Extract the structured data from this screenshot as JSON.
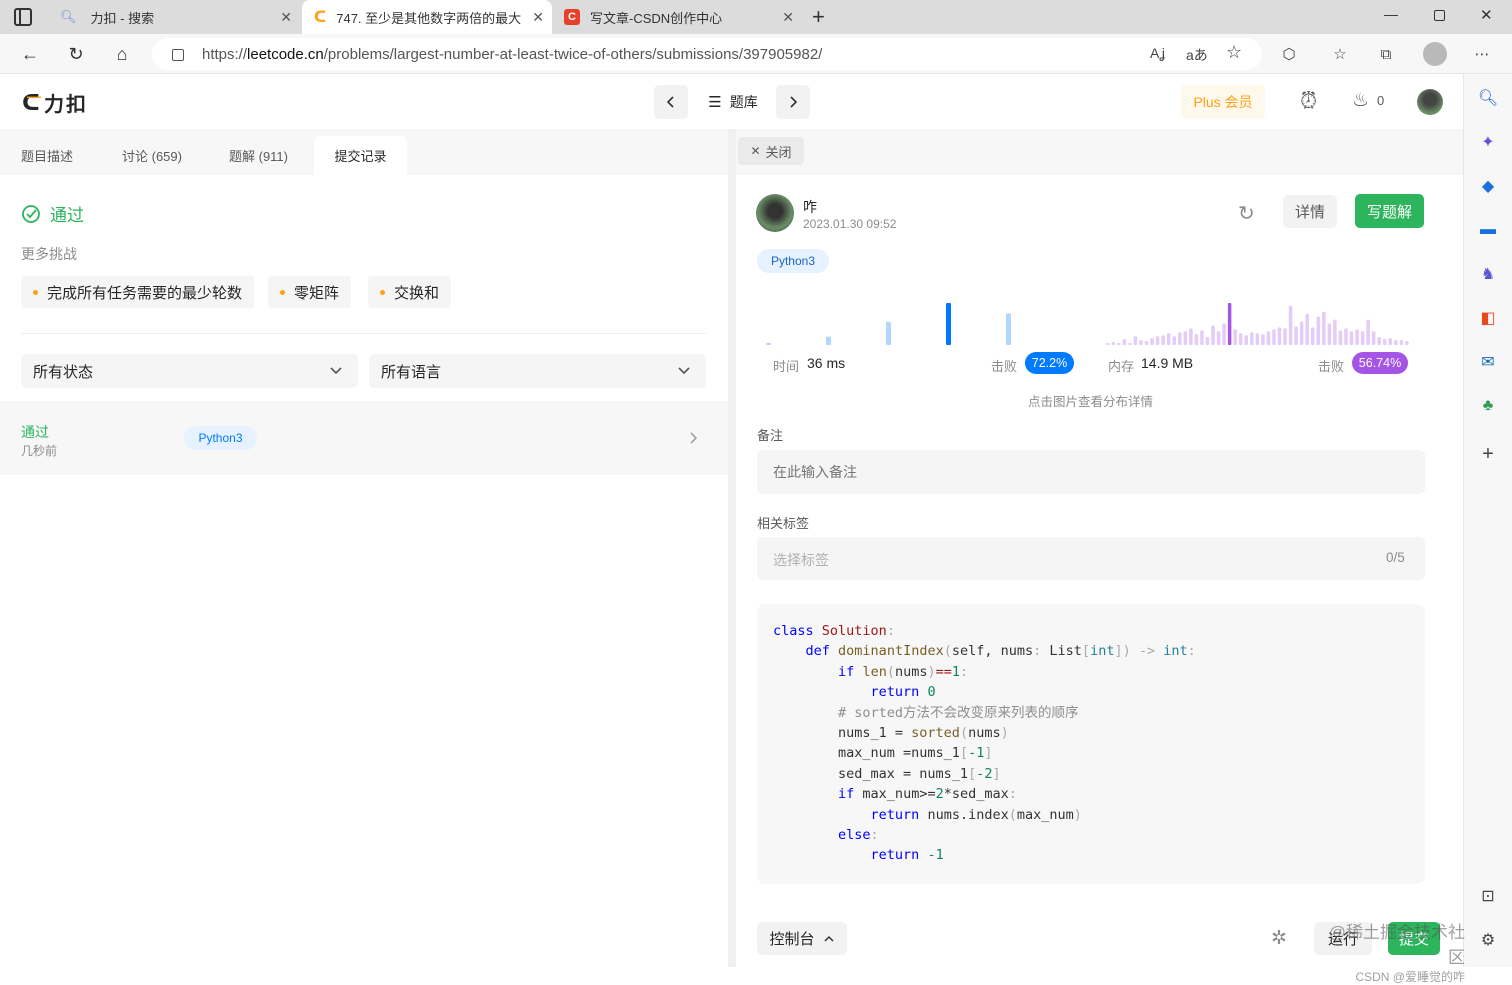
{
  "browser": {
    "tabs": [
      {
        "title": "力扣 - 搜索"
      },
      {
        "title": "747. 至少是其他数字两倍的最大"
      },
      {
        "title": "写文章-CSDN创作中心"
      }
    ],
    "url_prefix": "https://",
    "url_domain": "leetcode.cn",
    "url_path": "/problems/largest-number-at-least-twice-of-others/submissions/397905982/"
  },
  "header": {
    "logo_text": "力扣",
    "problem_list_label": "题库",
    "plus_label": "Plus 会员",
    "streak_count": "0"
  },
  "left": {
    "tabs": [
      {
        "label": "题目描述"
      },
      {
        "label": "讨论 (659)"
      },
      {
        "label": "题解 (911)"
      },
      {
        "label": "提交记录"
      }
    ],
    "result_label": "通过",
    "more_challenges_label": "更多挑战",
    "challenges": [
      {
        "label": "完成所有任务需要的最少轮数"
      },
      {
        "label": "零矩阵"
      },
      {
        "label": "交换和"
      }
    ],
    "filter_status": "所有状态",
    "filter_language": "所有语言",
    "submission": {
      "status": "通过",
      "time": "几秒前",
      "language": "Python3"
    }
  },
  "right": {
    "close_label": "关闭",
    "user_name": "咋",
    "submit_time": "2023.01.30 09:52",
    "details_label": "详情",
    "write_solution_label": "写题解",
    "language_badge": "Python3",
    "runtime_label": "时间",
    "runtime_value": "36 ms",
    "runtime_beats_label": "击败",
    "runtime_beats_value": "72.2%",
    "memory_label": "内存",
    "memory_value": "14.9 MB",
    "memory_beats_label": "击败",
    "memory_beats_value": "56.74%",
    "chart_hint": "点击图片查看分布详情",
    "notes_label": "备注",
    "notes_placeholder": "在此输入备注",
    "tags_label": "相关标签",
    "tags_placeholder": "选择标签",
    "tags_count": "0/5",
    "console_label": "控制台",
    "run_label": "运行",
    "submit_label": "提交",
    "colors": {
      "green": "#2db55d",
      "blue": "#007aff",
      "purple": "#a455e5",
      "orange": "#ffa116"
    }
  },
  "watermark": {
    "line1": "@稀土掘金技术社区",
    "line2": "CSDN @爱睡觉的咋"
  },
  "chart_data": [
    {
      "type": "bar",
      "title": "时间",
      "values": [
        2,
        8,
        22,
        40,
        30
      ],
      "highlight_index": 3,
      "color": "#007aff"
    },
    {
      "type": "bar",
      "title": "内存",
      "values": [
        2,
        3,
        2,
        6,
        2,
        9,
        5,
        4,
        7,
        9,
        10,
        12,
        9,
        13,
        14,
        17,
        11,
        15,
        8,
        20,
        14,
        22,
        43,
        16,
        12,
        10,
        13,
        12,
        11,
        14,
        16,
        18,
        17,
        40,
        19,
        24,
        32,
        18,
        29,
        34,
        22,
        26,
        15,
        17,
        14,
        16,
        14,
        26,
        14,
        8,
        6,
        7,
        5,
        5,
        4
      ],
      "highlight_index": 22,
      "color": "#a455e5"
    }
  ]
}
